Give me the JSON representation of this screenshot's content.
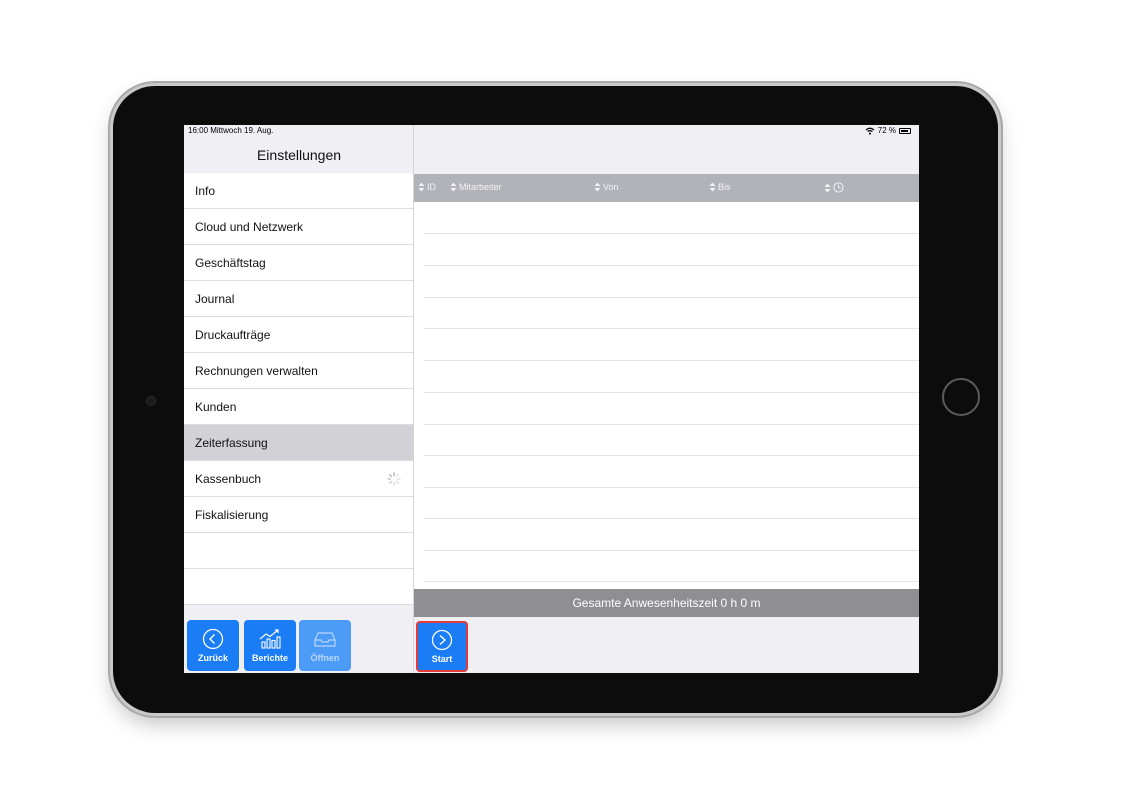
{
  "status_bar": {
    "time_date": "16:00  Mittwoch 19. Aug.",
    "battery": "72 %"
  },
  "sidebar": {
    "title": "Einstellungen",
    "items": [
      {
        "label": "Info"
      },
      {
        "label": "Cloud und Netzwerk"
      },
      {
        "label": "Geschäftstag"
      },
      {
        "label": "Journal"
      },
      {
        "label": "Druckaufträge"
      },
      {
        "label": "Rechnungen verwalten"
      },
      {
        "label": "Kunden"
      },
      {
        "label": "Zeiterfassung",
        "selected": true
      },
      {
        "label": "Kassenbuch"
      },
      {
        "label": "Fiskalisierung"
      }
    ],
    "toolbar": {
      "back_label": "Zurück",
      "reports_label": "Berichte",
      "open_label": "Öffnen"
    }
  },
  "table": {
    "columns": [
      "ID",
      "Mitarbeiter",
      "Von",
      "Bis"
    ],
    "duration_column_icon": "clock-icon"
  },
  "total": {
    "label": "Gesamte Anwesenheitszeit 0 h 0 m"
  },
  "start_button": {
    "label": "Start"
  },
  "colors": {
    "accent": "#1a7df5",
    "highlight_border": "#e23b3b",
    "selected_row": "#d1d1d6",
    "header": "#b2b2b9",
    "total_bar": "#8e8e93"
  }
}
